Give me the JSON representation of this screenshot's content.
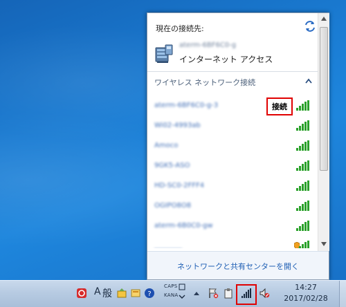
{
  "popup": {
    "current_label": "現在の接続先:",
    "current_network_name": "aterm-6BF6C0-g",
    "current_network_status": "インターネット アクセス",
    "section_header": "ワイヤレス ネットワーク接続",
    "connect_label": "接続",
    "footer_link": "ネットワークと共有センターを開く",
    "wifi_networks": [
      {
        "name": "aterm-6BF6C0-g-3",
        "signal_bars": 5,
        "secured_warning": false
      },
      {
        "name": "Wi02-4993ab",
        "signal_bars": 5,
        "secured_warning": false
      },
      {
        "name": "Amoco",
        "signal_bars": 5,
        "secured_warning": false
      },
      {
        "name": "9GK5-ASO",
        "signal_bars": 5,
        "secured_warning": false
      },
      {
        "name": "HD-SC0-2FFF4",
        "signal_bars": 5,
        "secured_warning": false
      },
      {
        "name": "OGIPO8O8",
        "signal_bars": 5,
        "secured_warning": false
      },
      {
        "name": "aterm-6B0C0-gw",
        "signal_bars": 5,
        "secured_warning": false
      },
      {
        "name": "________",
        "signal_bars": 5,
        "secured_warning": true
      }
    ]
  },
  "taskbar": {
    "ime_mode": "A",
    "ime_kanji": "般",
    "caps_label": "CAPS",
    "kana_label": "KANA",
    "time": "14:27",
    "date": "2017/02/28"
  },
  "colors": {
    "desktop": "#1a7cd3",
    "highlight": "#e00000",
    "signal_green": "#2aa12a",
    "link": "#1f5fb4"
  },
  "icons": {
    "refresh": "refresh-arrows-icon",
    "network": "network-computer-icon",
    "signal": "wifi-signal-icon",
    "shield": "security-shield-icon"
  }
}
